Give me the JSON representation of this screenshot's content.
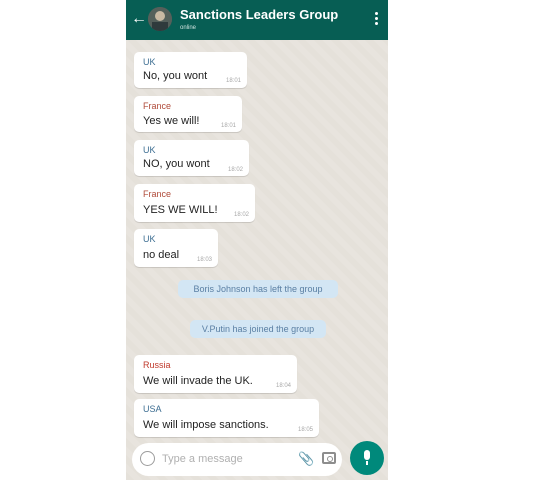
{
  "colors": {
    "header_bg": "#075e54",
    "uk": "#3d6e92",
    "france": "#b04b3a",
    "usa": "#3d6e92",
    "russia": "#c0392b",
    "system_text": "#5a7fa3",
    "mic_bg": "#00897b"
  },
  "header": {
    "back_icon": "arrow-left-icon",
    "title": "Sanctions Leaders Group",
    "subtitle": "online",
    "menu_icon": "more-vert-icon"
  },
  "messages": [
    {
      "sender": "UK",
      "text": "No, you wont",
      "time": "18:01"
    },
    {
      "sender": "France",
      "text": "Yes we will!",
      "time": "18:01"
    },
    {
      "sender": "UK",
      "text": "NO, you wont",
      "time": "18:02"
    },
    {
      "sender": "France",
      "text": "YES WE WILL!",
      "time": "18:02"
    },
    {
      "sender": "UK",
      "text": "no deal",
      "time": "18:03"
    }
  ],
  "system_messages": [
    "Boris Johnson has left the group",
    "V.Putin has joined the group"
  ],
  "messages_after": [
    {
      "sender": "Russia",
      "text": "We will invade the UK.",
      "time": "18:04"
    },
    {
      "sender": "USA",
      "text": "We will impose sanctions.",
      "time": "18:05"
    }
  ],
  "composer": {
    "placeholder": "Type a message",
    "emoji_icon": "emoji-icon",
    "attach_icon": "paperclip-icon",
    "camera_icon": "camera-icon",
    "mic_icon": "mic-icon"
  }
}
